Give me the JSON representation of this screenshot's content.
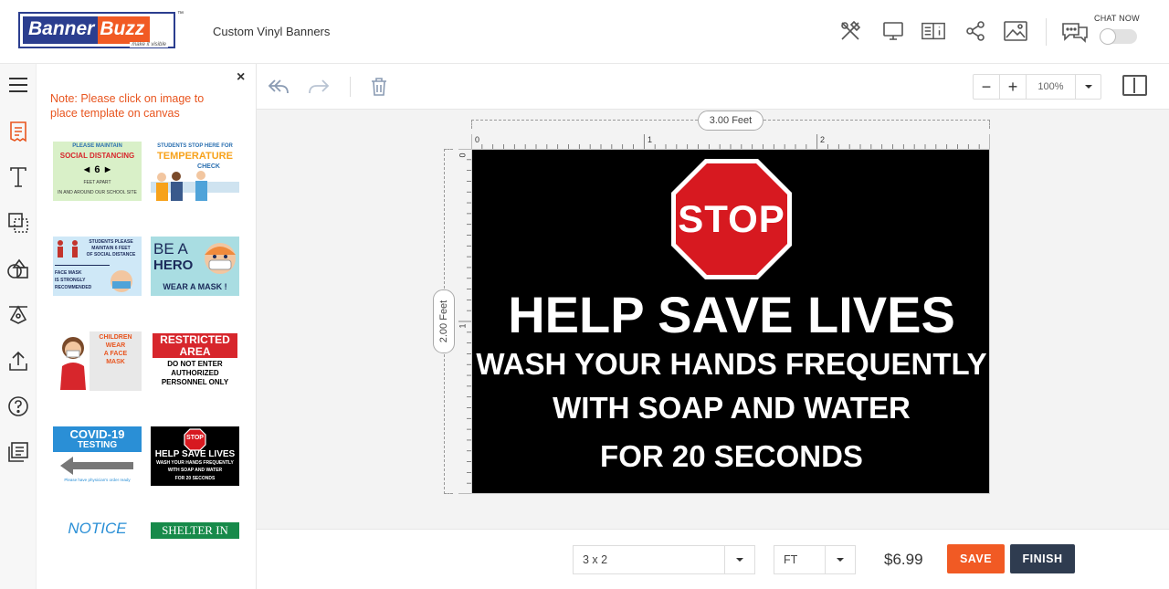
{
  "brand": {
    "part1": "Banner",
    "part2": "Buzz",
    "tagline": "make it visible",
    "tm": "™"
  },
  "header": {
    "title": "Custom Vinyl Banners",
    "chat_label": "CHAT NOW",
    "icons": [
      "design-tools-icon",
      "preview-icon",
      "specs-icon",
      "share-icon",
      "image-icon",
      "chat-icon"
    ]
  },
  "rail": {
    "icons": [
      "menu-icon",
      "templates-icon",
      "text-icon",
      "layers-icon",
      "shapes-icon",
      "clipart-icon",
      "upload-icon",
      "help-icon",
      "notes-icon"
    ]
  },
  "panel": {
    "close": "×",
    "note": "Note: Please click on image to place template on canvas",
    "templates": [
      {
        "lines": [
          "PLEASE MAINTAIN",
          "SOCIAL DISTANCING",
          "◄ 6 ►",
          "FEET APART",
          "IN AND AROUND OUR SCHOOL SITE"
        ]
      },
      {
        "lines": [
          "STUDENTS STOP HERE FOR",
          "TEMPERATURE",
          "CHECK"
        ]
      },
      {
        "lines": [
          "STUDENTS PLEASE",
          "MAINTAIN 6 FEET",
          "OF SOCIAL DISTANCE",
          "FACE MASK",
          "IS STRONGLY",
          "RECOMMENDED"
        ]
      },
      {
        "lines": [
          "BE A",
          "HERO",
          "WEAR A MASK !"
        ]
      },
      {
        "lines": [
          "CHILDREN",
          "WEAR",
          "A FACE",
          "MASK"
        ]
      },
      {
        "lines": [
          "RESTRICTED",
          "AREA",
          "DO NOT ENTER",
          "AUTHORIZED",
          "PERSONNEL ONLY"
        ]
      },
      {
        "lines": [
          "COVID-19",
          "TESTING",
          "Please have physician's order ready"
        ]
      },
      {
        "lines": [
          "STOP",
          "HELP SAVE LIVES",
          "WASH YOUR HANDS FREQUENTLY",
          "WITH SOAP AND WATER",
          "FOR 20 SECONDS"
        ]
      },
      {
        "lines": [
          "NOTICE"
        ]
      },
      {
        "lines": [
          "SHELTER IN"
        ]
      }
    ]
  },
  "toolbar": {
    "zoom": "100%",
    "zoom_minus": "−",
    "zoom_plus": "+"
  },
  "canvas": {
    "width_label": "3.00 Feet",
    "height_label": "2.00 Feet",
    "ruler_h": [
      "0",
      "1",
      "2"
    ],
    "ruler_v": [
      "0",
      "1"
    ],
    "stop": "STOP",
    "line1": "HELP SAVE LIVES",
    "line2": "WASH YOUR HANDS FREQUENTLY",
    "line3": "WITH SOAP AND WATER",
    "line4": "FOR 20 SECONDS",
    "colors": {
      "stop_red": "#d71920",
      "background": "#000000",
      "text": "#ffffff"
    }
  },
  "bottom": {
    "size": "3 x 2",
    "unit": "FT",
    "price": "$6.99",
    "save": "SAVE",
    "finish": "FINISH"
  }
}
